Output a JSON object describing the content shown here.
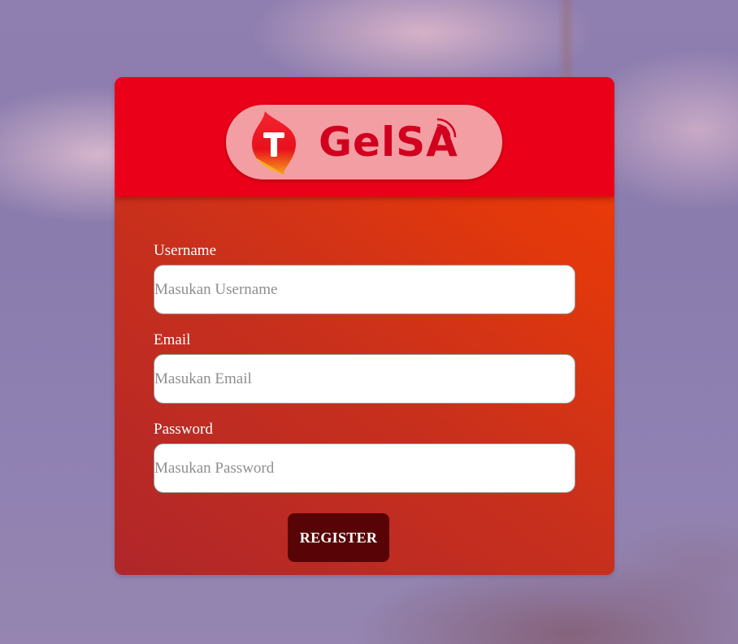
{
  "brand": {
    "logo_text": "GelSA",
    "logo_mark_letter": "T",
    "colors": {
      "header": "#ea0019",
      "pill": "#f39ea3",
      "logo_text": "#d2001f",
      "button": "#580406"
    }
  },
  "form": {
    "fields": [
      {
        "label": "Username",
        "placeholder": "Masukan Username",
        "value": ""
      },
      {
        "label": "Email",
        "placeholder": "Masukan Email",
        "value": ""
      },
      {
        "label": "Password",
        "placeholder": "Masukan Password",
        "value": ""
      }
    ],
    "submit_label": "REGISTER"
  },
  "icons": {
    "logo_mark": "telkomsel-flame-icon",
    "signal": "signal-waves-icon"
  }
}
